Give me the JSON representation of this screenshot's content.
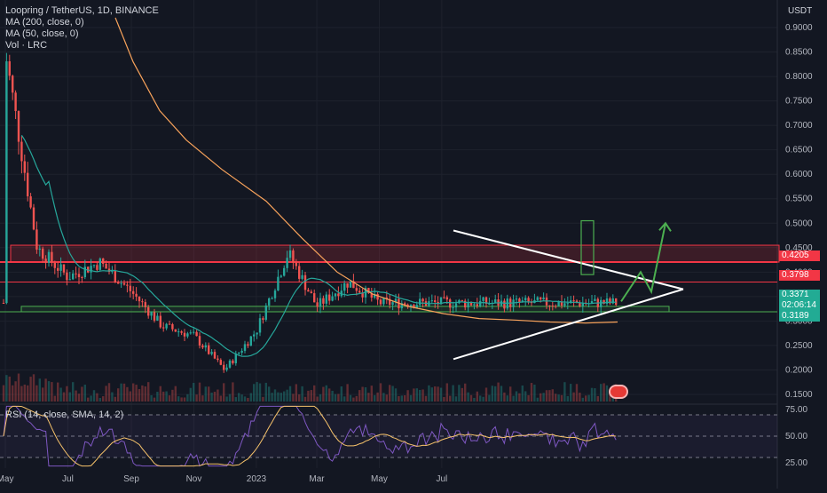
{
  "header": {
    "title": "Loopring / TetherUS, 1D, BINANCE",
    "ma200": "MA (200, close, 0)",
    "ma50": "MA (50, close, 0)",
    "vol": "Vol · LRC",
    "currency": "USDT"
  },
  "rsi_header": "RSI (14, close, SMA, 14, 2)",
  "price_badges": [
    {
      "label": "0.4205",
      "color": "#f23645"
    },
    {
      "label": "0.3798",
      "color": "#f23645"
    },
    {
      "label": "0.3371",
      "color": "#22ab94"
    },
    {
      "label": "02:06:14",
      "color": "#22ab94"
    },
    {
      "label": "0.3189",
      "color": "#22ab94"
    }
  ],
  "colors": {
    "bull": "#26a69a",
    "bear": "#ef5350",
    "ma50": "#26a69a",
    "ma200": "#f7a25b",
    "rsi": "#7e57c2",
    "rsi_ma": "#f7c36b",
    "resistance": "#f23645",
    "support": "#4caf50",
    "triangle": "#ffffff",
    "projection": "#4caf50"
  },
  "chart_data": [
    {
      "type": "candlestick",
      "title": "Loopring / TetherUS, 1D, BINANCE",
      "x_ticks": [
        "May",
        "Jul",
        "Sep",
        "Nov",
        "2023",
        "Mar",
        "May",
        "Jul"
      ],
      "y_ticks": [
        "0.9000",
        "0.8500",
        "0.8000",
        "0.7500",
        "0.7000",
        "0.6500",
        "0.6000",
        "0.5500",
        "0.5000",
        "0.4500",
        "0.4000",
        "0.3500",
        "0.3000",
        "0.2500",
        "0.2000",
        "0.1500"
      ],
      "ylim": [
        0.13,
        0.92
      ],
      "scale": "linear",
      "series_ma200": "MA (200, close, 0)",
      "series_ma50": "MA (50, close, 0)",
      "approx_close_path": [
        [
          "2022-05",
          0.85
        ],
        [
          "2022-06",
          0.45
        ],
        [
          "2022-07",
          0.39
        ],
        [
          "2022-08",
          0.42
        ],
        [
          "2022-09",
          0.36
        ],
        [
          "2022-10",
          0.29
        ],
        [
          "2022-11",
          0.27
        ],
        [
          "2022-12",
          0.2
        ],
        [
          "2023-01",
          0.28
        ],
        [
          "2023-02",
          0.44
        ],
        [
          "2023-03",
          0.33
        ],
        [
          "2023-04",
          0.38
        ],
        [
          "2023-05",
          0.3371
        ]
      ],
      "levels": {
        "resistance_high": 0.4205,
        "resistance_low": 0.3798,
        "last": 0.3371,
        "support": 0.3189
      },
      "zones": [
        {
          "kind": "resistance",
          "from": 0.4205,
          "to": 0.455
        },
        {
          "kind": "support",
          "from": 0.3189,
          "to": 0.33
        }
      ],
      "triangle": {
        "upper_start": 0.485,
        "lower_start": 0.222,
        "apex": 0.365
      },
      "projection": [
        0.34,
        0.4,
        0.36,
        0.5
      ]
    },
    {
      "type": "line",
      "title": "RSI (14, close, SMA, 14, 2)",
      "y_ticks": [
        "75.00",
        "50.00",
        "25.00"
      ],
      "ylim": [
        20,
        80
      ],
      "bands": [
        70,
        50,
        30
      ]
    }
  ]
}
